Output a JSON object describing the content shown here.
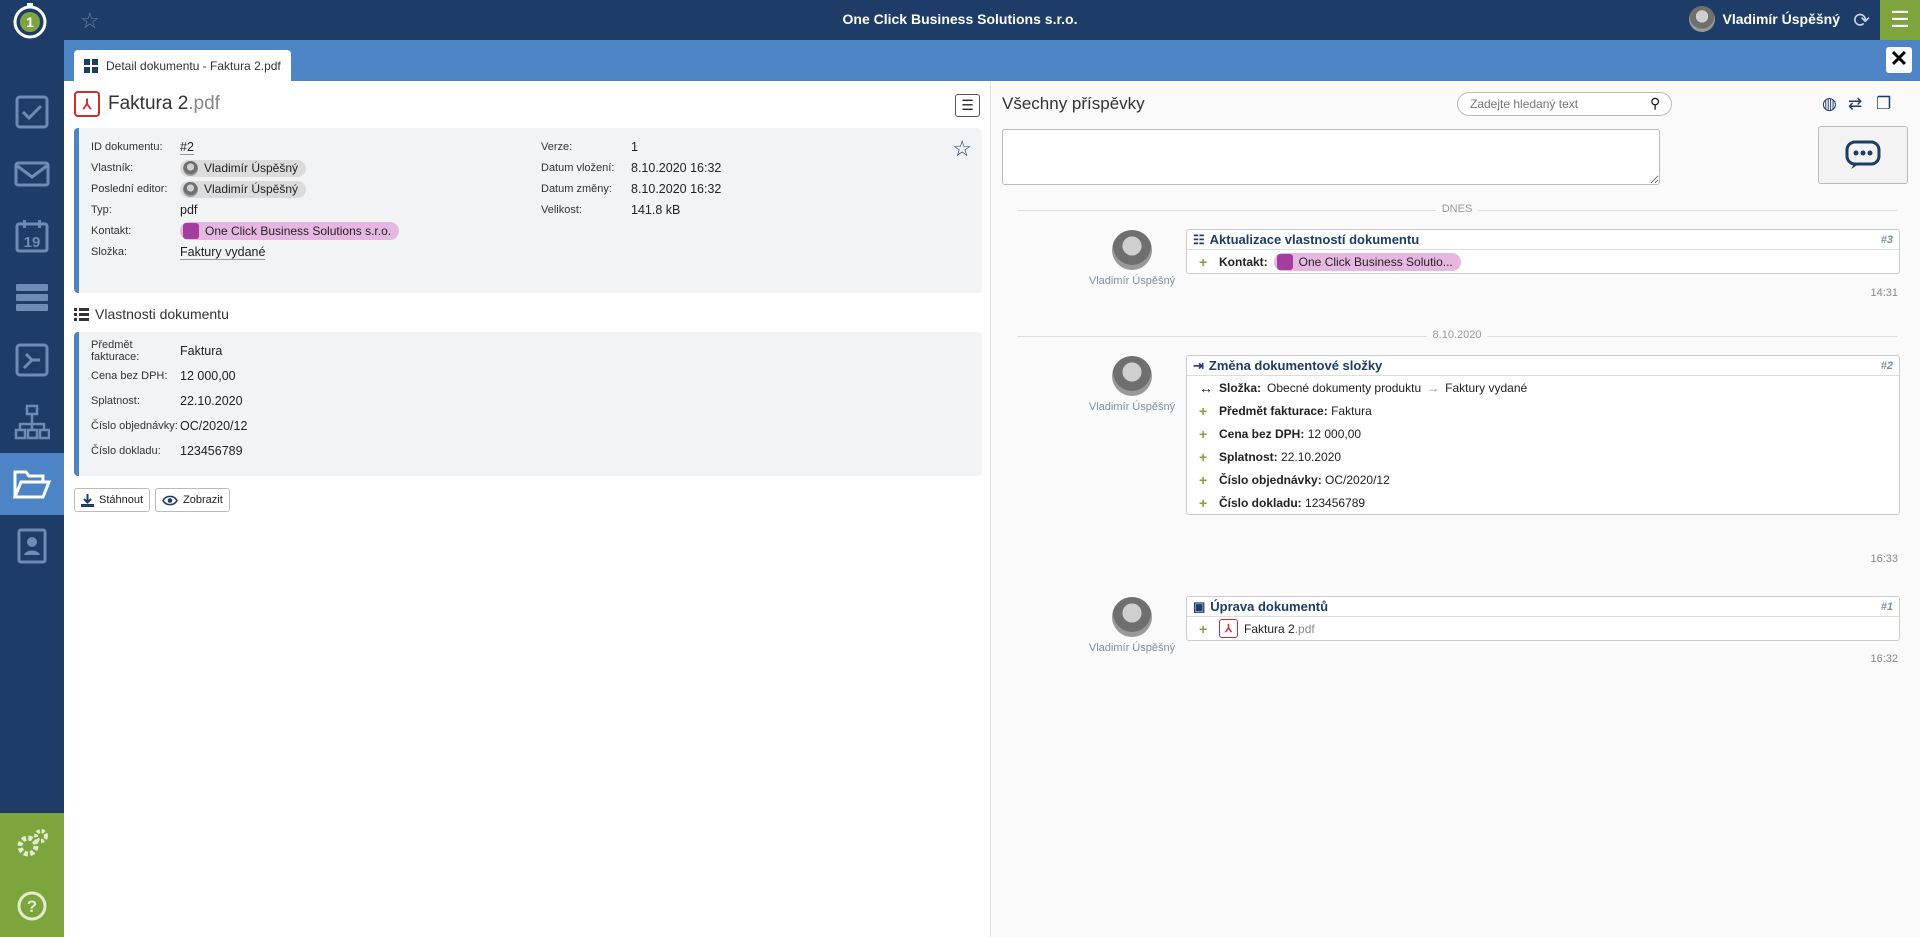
{
  "app": {
    "company": "One Click Business Solutions s.r.o.",
    "user": "Vladimír Úspěšný"
  },
  "tab": {
    "label": "Detail dokumentu - Faktura 2.pdf"
  },
  "document": {
    "name": "Faktura 2",
    "ext": ".pdf"
  },
  "info_left": [
    {
      "label": "ID dokumentu:",
      "value": "#2"
    },
    {
      "label": "Vlastník:",
      "value": "Vladimír Úspěšný"
    },
    {
      "label": "Poslední editor:",
      "value": "Vladimír Úspěšný"
    },
    {
      "label": "Typ:",
      "value": "pdf"
    },
    {
      "label": "Kontakt:",
      "value": "One Click Business Solutions s.r.o."
    },
    {
      "label": "Složka:",
      "value": "Faktury vydané"
    }
  ],
  "info_right": [
    {
      "label": "Verze:",
      "value": "1"
    },
    {
      "label": "Datum vložení:",
      "value": "8.10.2020 16:32"
    },
    {
      "label": "Datum změny:",
      "value": "8.10.2020 16:32"
    },
    {
      "label": "Velikost:",
      "value": "141.8 kB"
    }
  ],
  "properties": {
    "title": "Vlastnosti dokumentu",
    "rows": [
      {
        "label": "Předmět fakturace:",
        "value": "Faktura"
      },
      {
        "label": "Cena bez DPH:",
        "value": "12 000,00"
      },
      {
        "label": "Splatnost:",
        "value": "22.10.2020"
      },
      {
        "label": "Číslo objednávky:",
        "value": "OC/2020/12"
      },
      {
        "label": "Číslo dokladu:",
        "value": "123456789"
      }
    ]
  },
  "actions": {
    "download": "Stáhnout",
    "view": "Zobrazit"
  },
  "feed": {
    "title": "Všechny příspěvky",
    "search_placeholder": "Zadejte hledaný text",
    "sep_today": "DNES",
    "sep_date": "8.10.2020",
    "posts": [
      {
        "user": "Vladimír Úspěšný",
        "title": "Aktualizace vlastností dokumentu",
        "num": "#3",
        "time": "14:31",
        "row_label": "Kontakt:",
        "row_value": "One Click Business Solutio..."
      },
      {
        "user": "Vladimír Úspěšný",
        "title": "Změna dokumentové složky",
        "num": "#2",
        "time": "16:33",
        "folder_label": "Složka:",
        "folder_from": "Obecné dokumenty produktu",
        "folder_to": "Faktury vydané",
        "rows": [
          {
            "label": "Předmět fakturace:",
            "value": "Faktura"
          },
          {
            "label": "Cena bez DPH:",
            "value": "12 000,00"
          },
          {
            "label": "Splatnost:",
            "value": "22.10.2020"
          },
          {
            "label": "Číslo objednávky:",
            "value": "OC/2020/12"
          },
          {
            "label": "Číslo dokladu:",
            "value": "123456789"
          }
        ]
      },
      {
        "user": "Vladimír Úspěšný",
        "title": "Úprava dokumentů",
        "num": "#1",
        "time": "16:32",
        "file_name": "Faktura 2",
        "file_ext": ".pdf"
      }
    ]
  }
}
